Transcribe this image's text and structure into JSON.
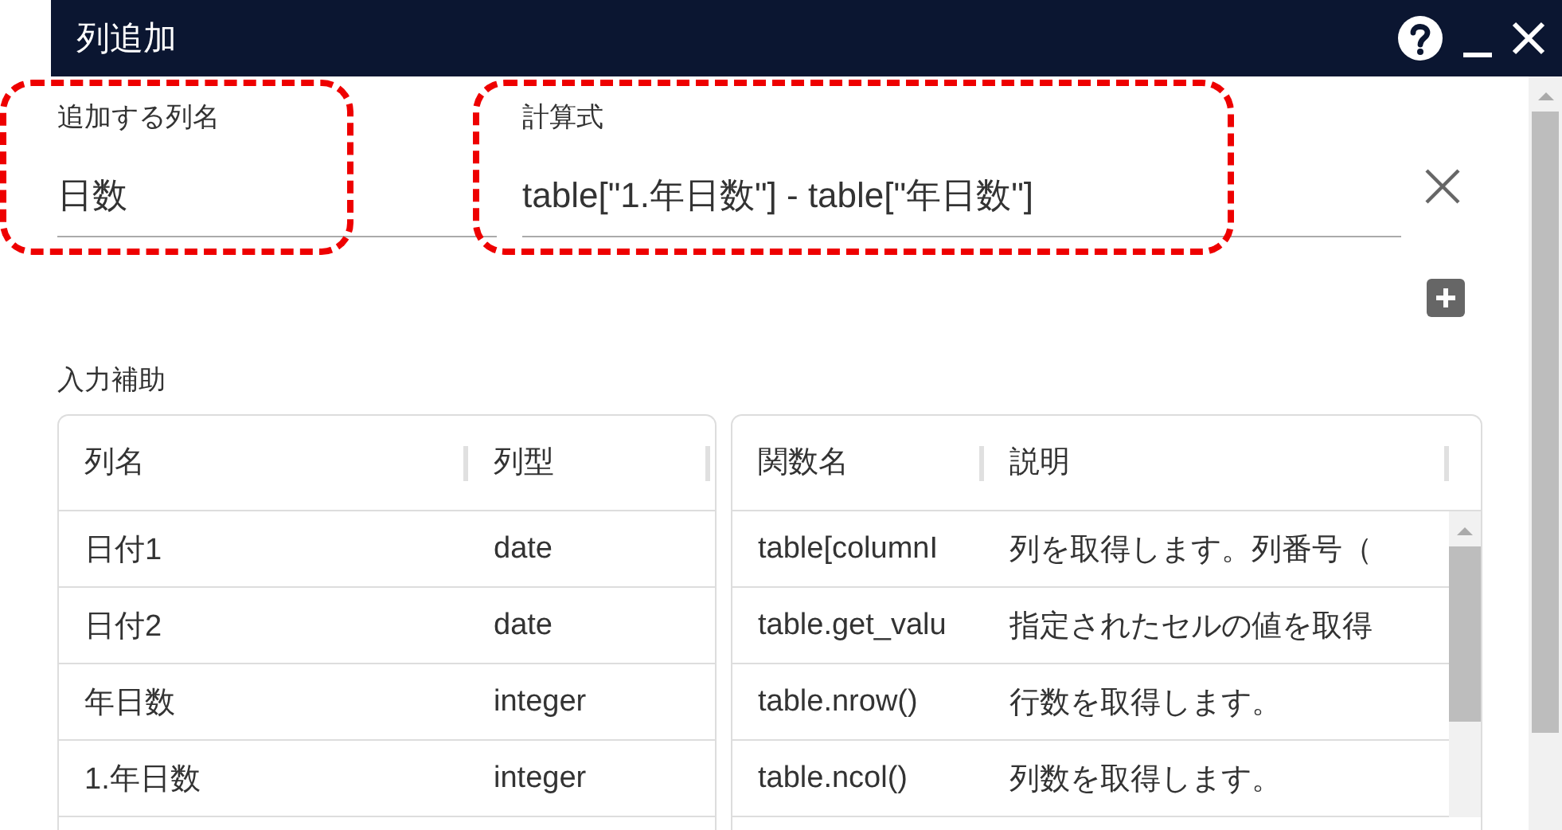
{
  "window": {
    "title": "列追加"
  },
  "fields": [
    {
      "label": "追加する列名",
      "value": "日数",
      "highlighted": true
    },
    {
      "label": "計算式",
      "value": "table[\"1.年日数\"] - table[\"年日数\"]",
      "highlighted": true
    }
  ],
  "section_label": "入力補助",
  "columns_table": {
    "columns": [
      "列名",
      "列型"
    ],
    "rows": [
      [
        "日付1",
        "date"
      ],
      [
        "日付2",
        "date"
      ],
      [
        "年日数",
        "integer"
      ],
      [
        "1.年日数",
        "integer"
      ]
    ]
  },
  "functions_table": {
    "columns": [
      "関数名",
      "説明"
    ],
    "rows": [
      [
        "table[columnI",
        "列を取得します。列番号（"
      ],
      [
        "table.get_valu",
        "指定されたセルの値を取得"
      ],
      [
        "table.nrow()",
        "行数を取得します。"
      ],
      [
        "table.ncol()",
        "列数を取得します。"
      ]
    ]
  }
}
